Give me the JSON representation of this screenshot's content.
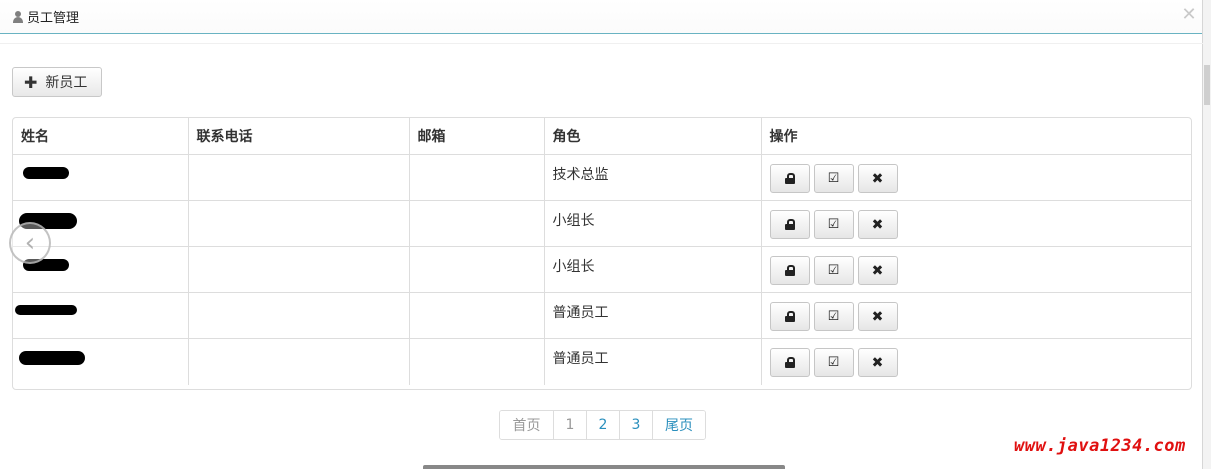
{
  "dialog": {
    "title": "员工管理",
    "title_icon": "user-icon",
    "close_icon": "close-icon"
  },
  "toolbar": {
    "new_label": "新员工",
    "new_icon": "plus-icon"
  },
  "table": {
    "headers": [
      "姓名",
      "联系电话",
      "邮箱",
      "角色",
      "操作"
    ],
    "rows": [
      {
        "name": "",
        "phone": "",
        "email": "",
        "role": "技术总监"
      },
      {
        "name": "",
        "phone": "",
        "email": "",
        "role": "小组长"
      },
      {
        "name": "",
        "phone": "",
        "email": "",
        "role": "小组长"
      },
      {
        "name": "",
        "phone": "",
        "email": "",
        "role": "普通员工"
      },
      {
        "name": "",
        "phone": "",
        "email": "",
        "role": "普通员工"
      }
    ],
    "row_actions": [
      "lock-icon",
      "edit-icon",
      "delete-icon"
    ]
  },
  "pagination": {
    "first": "首页",
    "pages": [
      "1",
      "2",
      "3"
    ],
    "last": "尾页",
    "current": "1"
  },
  "watermark": "www.java1234.com",
  "colors": {
    "accent": "#2a8fbd",
    "title_border": "#69b3c2",
    "watermark": "#e01010"
  }
}
